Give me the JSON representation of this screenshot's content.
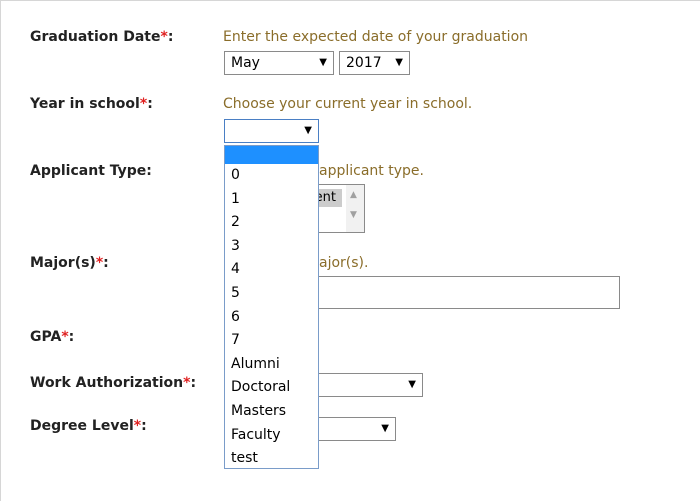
{
  "form": {
    "graduation": {
      "label": "Graduation Date",
      "required_mark": "*",
      "suffix": ":",
      "hint": "Enter the expected date of your graduation",
      "month_value": "May",
      "year_value": "2017"
    },
    "year_in_school": {
      "label": "Year in school",
      "required_mark": "*",
      "suffix": ":",
      "hint": "Choose your current year in school.",
      "value": ""
    },
    "applicant_type": {
      "label": "Applicant Type:",
      "hint_visible": "applicant type.",
      "selected_visible": "ent"
    },
    "majors": {
      "label": "Major(s)",
      "required_mark": "*",
      "suffix": ":",
      "hint_visible": "ajor(s)."
    },
    "gpa": {
      "label": "GPA",
      "required_mark": "*",
      "suffix": ":"
    },
    "work_authorization": {
      "label": "Work Authorization",
      "required_mark": "*",
      "suffix": ":"
    },
    "degree_level": {
      "label": "Degree Level",
      "required_mark": "*",
      "suffix": ":"
    }
  },
  "year_dropdown": {
    "options": [
      "",
      "0",
      "1",
      "2",
      "3",
      "4",
      "5",
      "6",
      "7",
      "Alumni",
      "Doctoral",
      "Masters",
      "Faculty",
      "test"
    ],
    "highlighted_index": 0
  },
  "icons": {
    "caret": "▼",
    "scroll_up": "▲",
    "scroll_down": "▼"
  }
}
